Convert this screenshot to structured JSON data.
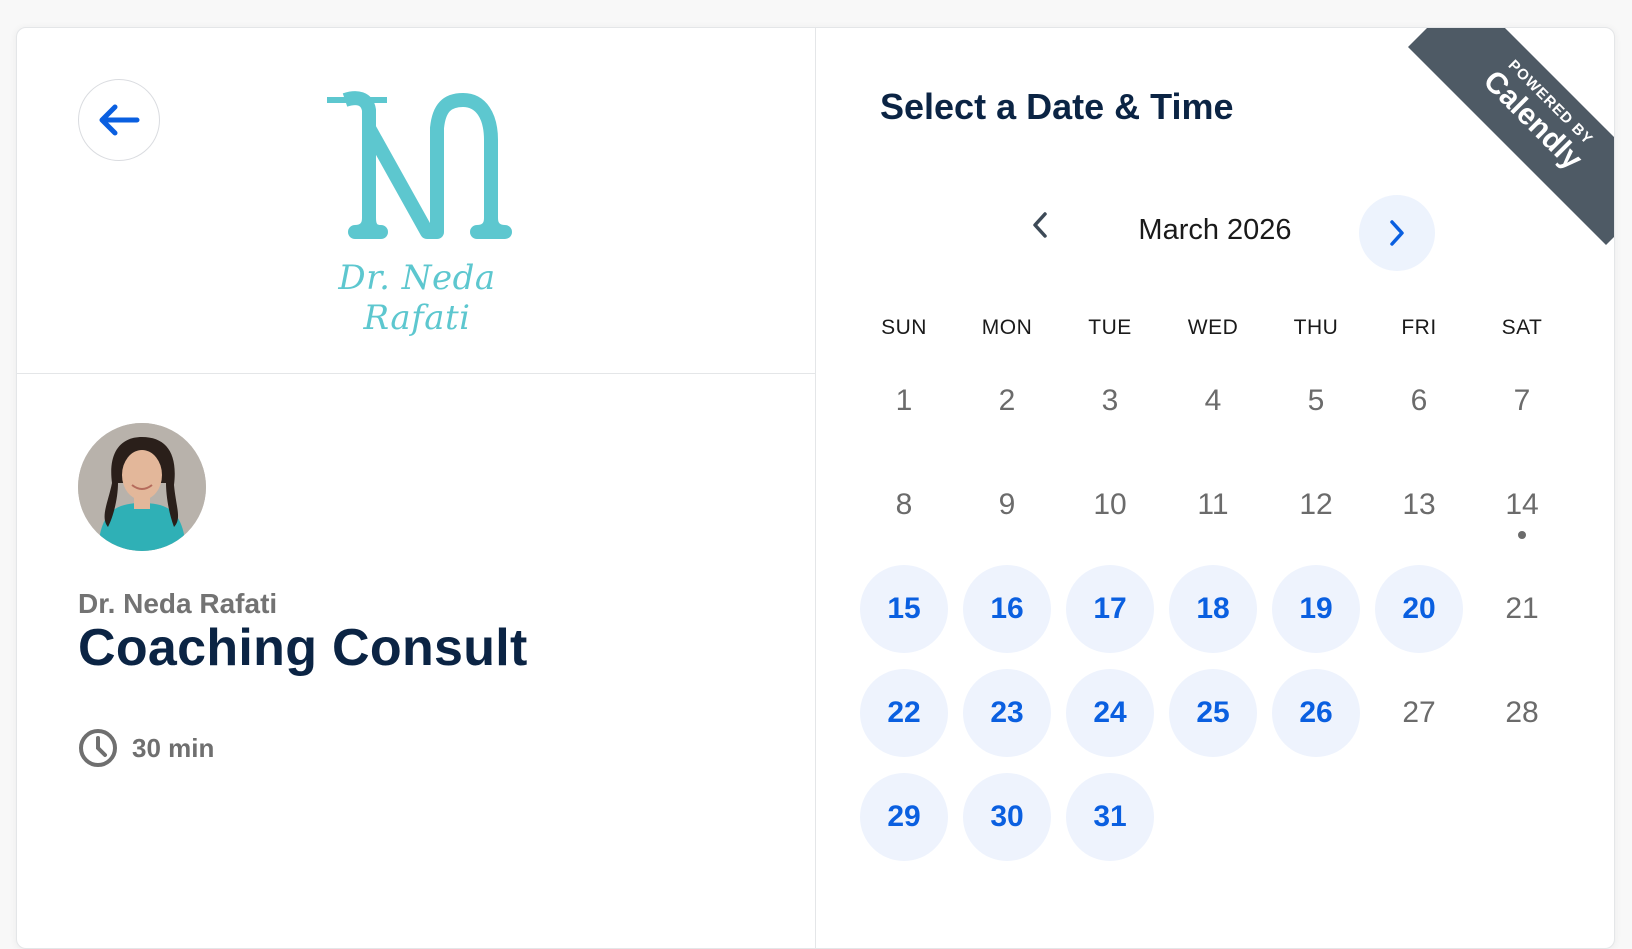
{
  "header": {
    "back_icon": "arrow-left-icon",
    "logo_text": "Dr. Neda Rafati"
  },
  "event": {
    "host_name": "Dr. Neda Rafati",
    "title": "Coaching Consult",
    "duration": "30 min",
    "duration_icon": "clock-icon"
  },
  "scheduler": {
    "title": "Select a Date & Time",
    "month": "March 2026",
    "prev_icon": "chevron-left-icon",
    "next_icon": "chevron-right-icon",
    "weekdays": [
      "SUN",
      "MON",
      "TUE",
      "WED",
      "THU",
      "FRI",
      "SAT"
    ],
    "days": [
      {
        "label": "1",
        "available": false
      },
      {
        "label": "2",
        "available": false
      },
      {
        "label": "3",
        "available": false
      },
      {
        "label": "4",
        "available": false
      },
      {
        "label": "5",
        "available": false
      },
      {
        "label": "6",
        "available": false
      },
      {
        "label": "7",
        "available": false
      },
      {
        "label": "8",
        "available": false
      },
      {
        "label": "9",
        "available": false
      },
      {
        "label": "10",
        "available": false
      },
      {
        "label": "11",
        "available": false
      },
      {
        "label": "12",
        "available": false
      },
      {
        "label": "13",
        "available": false
      },
      {
        "label": "14",
        "available": false,
        "today": true
      },
      {
        "label": "15",
        "available": true
      },
      {
        "label": "16",
        "available": true
      },
      {
        "label": "17",
        "available": true
      },
      {
        "label": "18",
        "available": true
      },
      {
        "label": "19",
        "available": true
      },
      {
        "label": "20",
        "available": true
      },
      {
        "label": "21",
        "available": false
      },
      {
        "label": "22",
        "available": true
      },
      {
        "label": "23",
        "available": true
      },
      {
        "label": "24",
        "available": true
      },
      {
        "label": "25",
        "available": true
      },
      {
        "label": "26",
        "available": true
      },
      {
        "label": "27",
        "available": false
      },
      {
        "label": "28",
        "available": false
      },
      {
        "label": "29",
        "available": true
      },
      {
        "label": "30",
        "available": true
      },
      {
        "label": "31",
        "available": true
      }
    ]
  },
  "ribbon": {
    "small": "POWERED BY",
    "brand": "Calendly"
  },
  "colors": {
    "accent": "#0a5fe0",
    "available_bg": "#eef3fd",
    "heading": "#0b2444",
    "logo": "#5dc7cf",
    "ribbon": "#4e5a65"
  }
}
